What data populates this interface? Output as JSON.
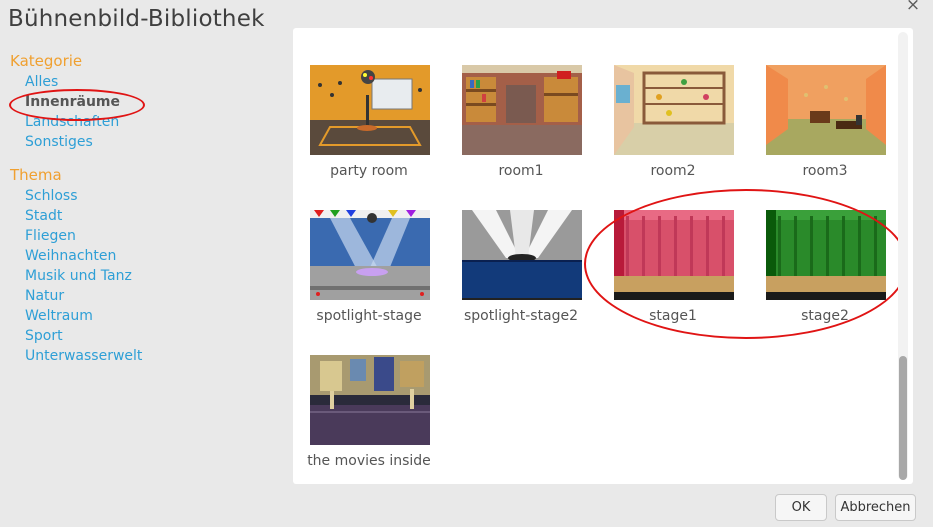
{
  "dialog": {
    "title": "Bühnenbild-Bibliothek",
    "close_glyph": "×"
  },
  "sidebar": {
    "category_heading": "Kategorie",
    "categories": [
      {
        "label": "Alles"
      },
      {
        "label": "Innenräume",
        "selected": true
      },
      {
        "label": "Landschaften"
      },
      {
        "label": "Sonstiges"
      }
    ],
    "theme_heading": "Thema",
    "themes": [
      {
        "label": "Schloss"
      },
      {
        "label": "Stadt"
      },
      {
        "label": "Fliegen"
      },
      {
        "label": "Weihnachten"
      },
      {
        "label": "Musik und Tanz"
      },
      {
        "label": "Natur"
      },
      {
        "label": "Weltraum"
      },
      {
        "label": "Sport"
      },
      {
        "label": "Unterwasserwelt"
      }
    ]
  },
  "library": {
    "items": [
      {
        "name": "party room",
        "icon": "party-room-thumbnail"
      },
      {
        "name": "room1",
        "icon": "room1-thumbnail"
      },
      {
        "name": "room2",
        "icon": "room2-thumbnail"
      },
      {
        "name": "room3",
        "icon": "room3-thumbnail"
      },
      {
        "name": "spotlight-stage",
        "icon": "spotlight-stage-thumbnail"
      },
      {
        "name": "spotlight-stage2",
        "icon": "spotlight-stage2-thumbnail"
      },
      {
        "name": "stage1",
        "icon": "stage1-thumbnail",
        "highlighted": true
      },
      {
        "name": "stage2",
        "icon": "stage2-thumbnail",
        "highlighted": true
      },
      {
        "name": "the movies inside",
        "icon": "movies-inside-thumbnail"
      }
    ]
  },
  "buttons": {
    "ok_label": "OK",
    "cancel_label": "Abbrechen"
  },
  "colors": {
    "accent_heading": "#f0a030",
    "link": "#2e9fd6",
    "annotation_red": "#e01414"
  }
}
